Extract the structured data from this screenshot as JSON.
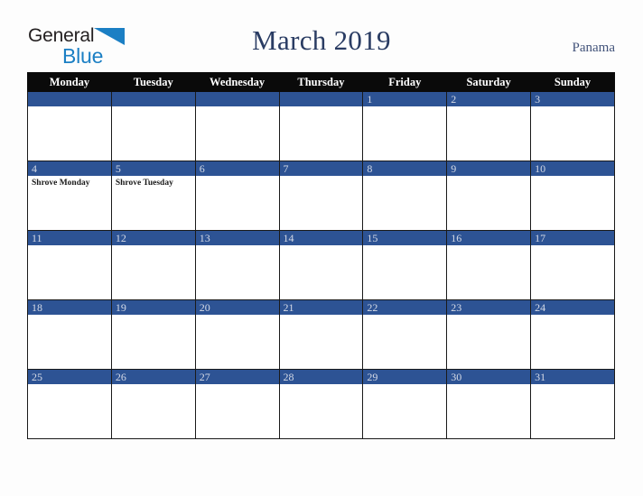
{
  "brand": {
    "name_part1": "General",
    "name_part2": "Blue",
    "triangle_color": "#1b7fc4",
    "text_color": "#231f20"
  },
  "header": {
    "title": "March 2019",
    "country": "Panama",
    "title_color": "#2a3c63",
    "country_color": "#42537a"
  },
  "calendar": {
    "month": "March",
    "year": "2019",
    "weekday_headers": [
      "Monday",
      "Tuesday",
      "Wednesday",
      "Thursday",
      "Friday",
      "Saturday",
      "Sunday"
    ],
    "header_bg": "#0a0a0a",
    "header_text_color": "#ffffff",
    "date_band_bg": "#2d5394",
    "date_band_text_color": "#d5dae6",
    "cell_bg": "#ffffff",
    "weeks": [
      [
        {
          "date": "",
          "holiday": ""
        },
        {
          "date": "",
          "holiday": ""
        },
        {
          "date": "",
          "holiday": ""
        },
        {
          "date": "",
          "holiday": ""
        },
        {
          "date": "1",
          "holiday": ""
        },
        {
          "date": "2",
          "holiday": ""
        },
        {
          "date": "3",
          "holiday": ""
        }
      ],
      [
        {
          "date": "4",
          "holiday": "Shrove Monday"
        },
        {
          "date": "5",
          "holiday": "Shrove Tuesday"
        },
        {
          "date": "6",
          "holiday": ""
        },
        {
          "date": "7",
          "holiday": ""
        },
        {
          "date": "8",
          "holiday": ""
        },
        {
          "date": "9",
          "holiday": ""
        },
        {
          "date": "10",
          "holiday": ""
        }
      ],
      [
        {
          "date": "11",
          "holiday": ""
        },
        {
          "date": "12",
          "holiday": ""
        },
        {
          "date": "13",
          "holiday": ""
        },
        {
          "date": "14",
          "holiday": ""
        },
        {
          "date": "15",
          "holiday": ""
        },
        {
          "date": "16",
          "holiday": ""
        },
        {
          "date": "17",
          "holiday": ""
        }
      ],
      [
        {
          "date": "18",
          "holiday": ""
        },
        {
          "date": "19",
          "holiday": ""
        },
        {
          "date": "20",
          "holiday": ""
        },
        {
          "date": "21",
          "holiday": ""
        },
        {
          "date": "22",
          "holiday": ""
        },
        {
          "date": "23",
          "holiday": ""
        },
        {
          "date": "24",
          "holiday": ""
        }
      ],
      [
        {
          "date": "25",
          "holiday": ""
        },
        {
          "date": "26",
          "holiday": ""
        },
        {
          "date": "27",
          "holiday": ""
        },
        {
          "date": "28",
          "holiday": ""
        },
        {
          "date": "29",
          "holiday": ""
        },
        {
          "date": "30",
          "holiday": ""
        },
        {
          "date": "31",
          "holiday": ""
        }
      ]
    ]
  }
}
